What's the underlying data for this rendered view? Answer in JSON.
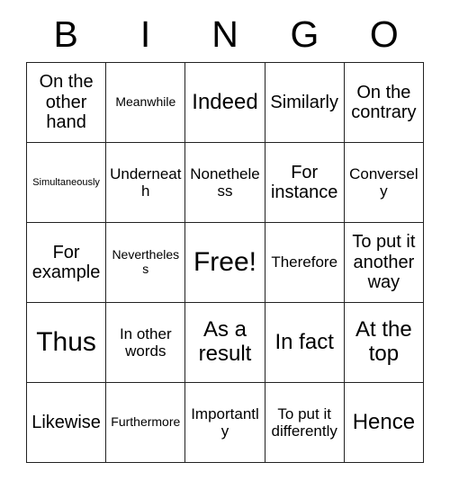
{
  "card": {
    "header_letters": [
      "B",
      "I",
      "N",
      "G",
      "O"
    ],
    "rows": [
      [
        {
          "text": "On the other hand",
          "size": "md"
        },
        {
          "text": "Meanwhile",
          "size": "xs"
        },
        {
          "text": "Indeed",
          "size": "lg"
        },
        {
          "text": "Similarly",
          "size": "md"
        },
        {
          "text": "On the contrary",
          "size": "md"
        }
      ],
      [
        {
          "text": "Simultaneously",
          "size": "xxs"
        },
        {
          "text": "Underneath",
          "size": "sm"
        },
        {
          "text": "Nonetheless",
          "size": "sm"
        },
        {
          "text": "For instance",
          "size": "md"
        },
        {
          "text": "Conversely",
          "size": "sm"
        }
      ],
      [
        {
          "text": "For example",
          "size": "md"
        },
        {
          "text": "Nevertheless",
          "size": "xs"
        },
        {
          "text": "Free!",
          "size": "xl"
        },
        {
          "text": "Therefore",
          "size": "sm"
        },
        {
          "text": "To put it another way",
          "size": "md"
        }
      ],
      [
        {
          "text": "Thus",
          "size": "xl"
        },
        {
          "text": "In other words",
          "size": "sm"
        },
        {
          "text": "As a result",
          "size": "lg"
        },
        {
          "text": "In fact",
          "size": "lg"
        },
        {
          "text": "At the top",
          "size": "lg"
        }
      ],
      [
        {
          "text": "Likewise",
          "size": "md"
        },
        {
          "text": "Furthermore",
          "size": "xs"
        },
        {
          "text": "Importantly",
          "size": "sm"
        },
        {
          "text": "To put it differently",
          "size": "sm"
        },
        {
          "text": "Hence",
          "size": "lg"
        }
      ]
    ]
  },
  "colors": {
    "background": "#ffffff",
    "text": "#000000",
    "grid_line": "#222222"
  }
}
